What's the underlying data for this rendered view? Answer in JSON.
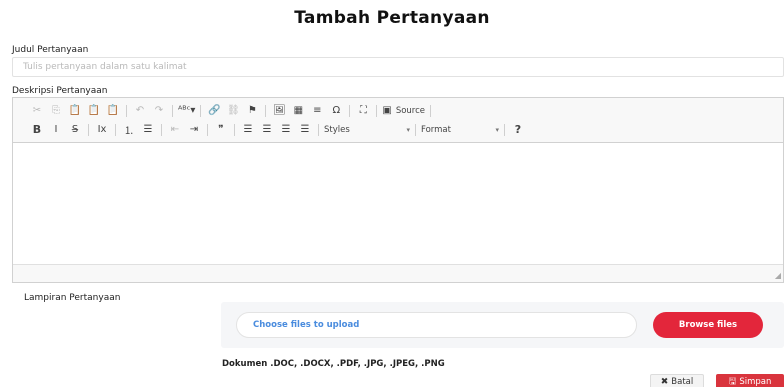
{
  "page": {
    "title": "Tambah Pertanyaan"
  },
  "judul": {
    "label": "Judul Pertanyaan",
    "placeholder": "Tulis pertanyaan dalam satu kalimat",
    "value": ""
  },
  "deskripsi": {
    "label": "Deskripsi Pertanyaan",
    "toolbar": {
      "row1": [
        {
          "icon": "cut-icon",
          "glyph": "✂",
          "enabled": false
        },
        {
          "icon": "copy-icon",
          "glyph": "⎘",
          "enabled": false
        },
        {
          "icon": "paste-icon",
          "glyph": "📋",
          "enabled": true
        },
        {
          "icon": "paste-text-icon",
          "glyph": "📋",
          "enabled": true
        },
        {
          "icon": "paste-word-icon",
          "glyph": "📋",
          "enabled": true
        },
        {
          "sep": true
        },
        {
          "icon": "undo-icon",
          "glyph": "↶",
          "enabled": false
        },
        {
          "icon": "redo-icon",
          "glyph": "↷",
          "enabled": false
        },
        {
          "sep": true
        },
        {
          "icon": "spellcheck-icon",
          "glyph": "ᴬᴮᶜ▾",
          "enabled": true
        },
        {
          "sep": true
        },
        {
          "icon": "link-icon",
          "glyph": "🔗",
          "enabled": true
        },
        {
          "icon": "unlink-icon",
          "glyph": "⛓",
          "enabled": false
        },
        {
          "icon": "anchor-icon",
          "glyph": "⚑",
          "enabled": true
        },
        {
          "sep": true
        },
        {
          "icon": "image-icon",
          "glyph": "🖼",
          "enabled": true
        },
        {
          "icon": "table-icon",
          "glyph": "▦",
          "enabled": true
        },
        {
          "icon": "horizontal-line-icon",
          "glyph": "≡",
          "enabled": true
        },
        {
          "icon": "special-char-icon",
          "glyph": "Ω",
          "enabled": true
        },
        {
          "sep": true
        },
        {
          "icon": "maximize-icon",
          "glyph": "⛶",
          "enabled": true
        },
        {
          "sep": true
        },
        {
          "icon": "source-icon",
          "glyph": "▣",
          "enabled": true,
          "label": "Source"
        },
        {
          "sep": true
        }
      ],
      "row2": [
        {
          "icon": "bold-icon",
          "glyph": "B",
          "enabled": true,
          "bold": true
        },
        {
          "icon": "italic-icon",
          "glyph": "I",
          "enabled": true
        },
        {
          "icon": "strike-icon",
          "glyph": "S̶",
          "enabled": true
        },
        {
          "sep": true
        },
        {
          "icon": "remove-format-icon",
          "glyph": "Ix",
          "enabled": true
        },
        {
          "sep": true
        },
        {
          "icon": "numbered-list-icon",
          "glyph": "⒈",
          "enabled": true
        },
        {
          "icon": "bulleted-list-icon",
          "glyph": "☰",
          "enabled": true
        },
        {
          "sep": true
        },
        {
          "icon": "outdent-icon",
          "glyph": "⇤",
          "enabled": false
        },
        {
          "icon": "indent-icon",
          "glyph": "⇥",
          "enabled": true
        },
        {
          "sep": true
        },
        {
          "icon": "blockquote-icon",
          "glyph": "❞",
          "enabled": true
        },
        {
          "sep": true
        },
        {
          "icon": "align-left-icon",
          "glyph": "☰",
          "enabled": true
        },
        {
          "icon": "align-center-icon",
          "glyph": "☰",
          "enabled": true
        },
        {
          "icon": "align-right-icon",
          "glyph": "☰",
          "enabled": true
        },
        {
          "icon": "align-justify-icon",
          "glyph": "☰",
          "enabled": true
        },
        {
          "sep": true
        },
        {
          "combo": true,
          "name": "styles-dropdown",
          "label": "Styles",
          "width": 86
        },
        {
          "sep": true
        },
        {
          "combo": true,
          "name": "format-dropdown",
          "label": "Format",
          "width": 78
        },
        {
          "sep": true
        },
        {
          "icon": "help-icon",
          "glyph": "?",
          "enabled": true,
          "bold": true
        }
      ]
    }
  },
  "lampiran": {
    "label": "Lampiran Pertanyaan",
    "upload_text": "Choose files to upload",
    "browse_label": "Browse files",
    "file_types": "Dokumen .DOC, .DOCX, .PDF, .JPG, .JPEG, .PNG"
  },
  "actions": {
    "cancel_label": "Batal",
    "save_label": "Simpan"
  },
  "colors": {
    "accent": "#e3263b",
    "save": "#d9343d",
    "link": "#4a8cde"
  }
}
